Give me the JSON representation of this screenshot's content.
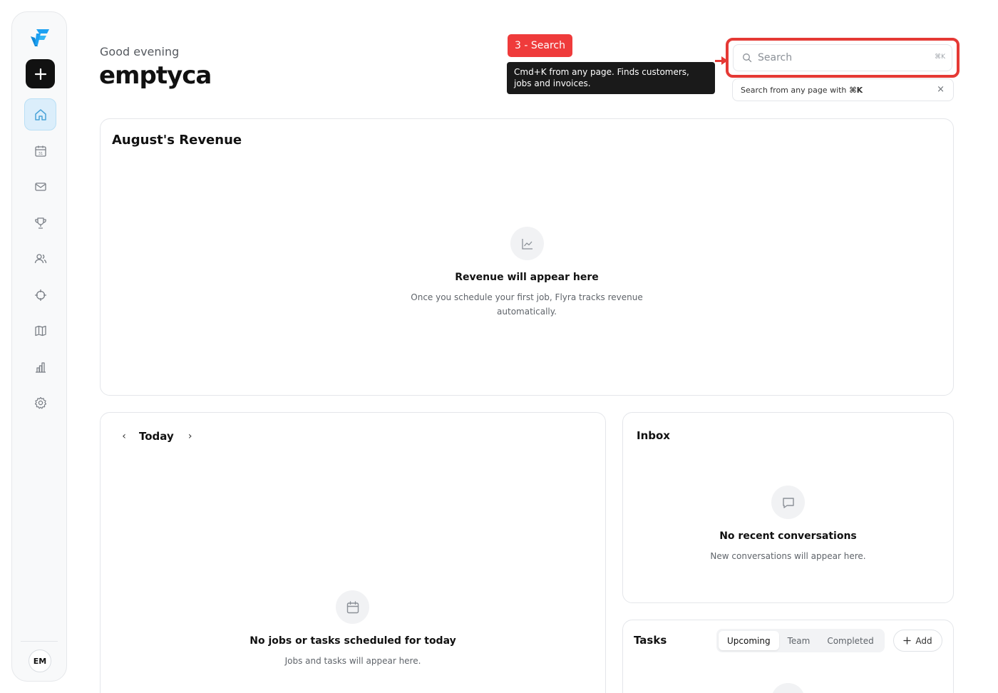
{
  "sidebar": {
    "logo": "flyra-logo",
    "new_button_icon": "plus-icon",
    "items": [
      {
        "name": "home",
        "icon": "home-icon",
        "active": true
      },
      {
        "name": "calendar",
        "icon": "calendar-icon",
        "active": false
      },
      {
        "name": "inbox",
        "icon": "mail-icon",
        "active": false
      },
      {
        "name": "achievements",
        "icon": "trophy-icon",
        "active": false
      },
      {
        "name": "customers",
        "icon": "users-icon",
        "active": false
      },
      {
        "name": "targets",
        "icon": "crosshair-icon",
        "active": false
      },
      {
        "name": "map",
        "icon": "map-icon",
        "active": false
      },
      {
        "name": "reports",
        "icon": "bar-chart-icon",
        "active": false
      },
      {
        "name": "settings",
        "icon": "gear-icon",
        "active": false
      }
    ],
    "avatar_initials": "EM"
  },
  "header": {
    "greeting": "Good evening",
    "username": "emptyca"
  },
  "tour": {
    "step_label": "3 - Search",
    "tooltip": "Cmd+K from any page. Finds customers, jobs and invoices.",
    "highlight_color": "#e53935"
  },
  "search": {
    "placeholder": "Search",
    "shortcut": "⌘K",
    "hint_text": "Search from any page with",
    "hint_shortcut": "⌘K",
    "hint_close": "×"
  },
  "revenue": {
    "title": "August's Revenue",
    "empty_icon": "line-chart-icon",
    "empty_title": "Revenue will appear here",
    "empty_sub": "Once you schedule your first job, Flyra tracks revenue automatically."
  },
  "schedule": {
    "prev": "‹",
    "label": "Today",
    "next": "›",
    "empty_icon": "calendar-icon",
    "empty_title": "No jobs or tasks scheduled for today",
    "empty_sub": "Jobs and tasks will appear here."
  },
  "inbox": {
    "title": "Inbox",
    "empty_icon": "message-icon",
    "empty_title": "No recent conversations",
    "empty_sub": "New conversations will appear here."
  },
  "tasks": {
    "title": "Tasks",
    "tabs": [
      "Upcoming",
      "Team",
      "Completed"
    ],
    "active_tab": "Upcoming",
    "add_label": "Add"
  },
  "colors": {
    "accent": "#1da1f2",
    "tour_red": "#ef3b3b"
  }
}
